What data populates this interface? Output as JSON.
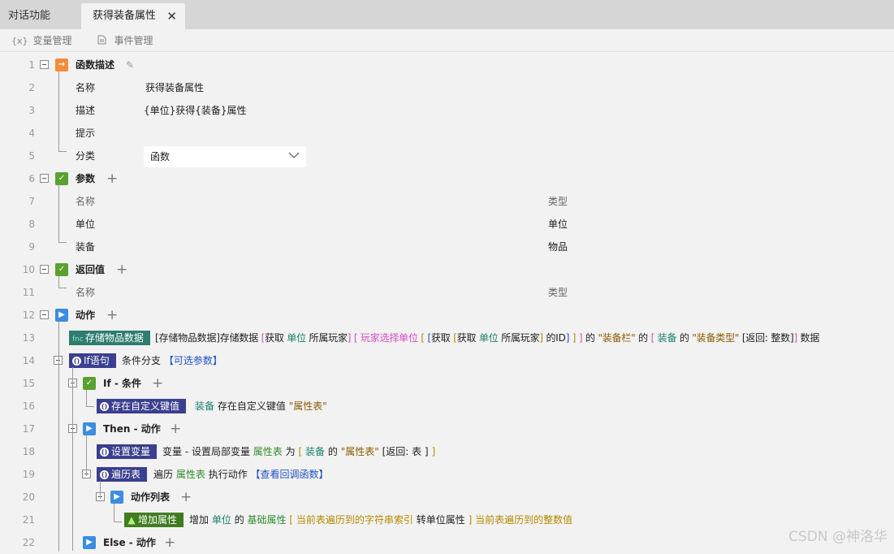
{
  "tabs": [
    {
      "label": "对话功能",
      "active": false
    },
    {
      "label": "获得装备属性",
      "active": true
    }
  ],
  "tab_close_glyph": "✕",
  "toolbar": {
    "vars_icon": "{x}",
    "vars_label": "变量管理",
    "events_label": "事件管理"
  },
  "line_numbers": [
    "1",
    "2",
    "3",
    "4",
    "5",
    "6",
    "7",
    "8",
    "9",
    "10",
    "11",
    "12",
    "13",
    "14",
    "15",
    "16",
    "17",
    "18",
    "19",
    "20",
    "21",
    "22"
  ],
  "func_desc": {
    "header": "函数描述",
    "name_label": "名称",
    "name_value": "获得装备属性",
    "desc_label": "描述",
    "desc_value": "{单位}获得{装备}属性",
    "hint_label": "提示",
    "category_label": "分类",
    "category_value": "函数"
  },
  "params": {
    "header": "参数",
    "col_name": "名称",
    "col_type": "类型",
    "rows": [
      {
        "name": "单位",
        "type": "单位"
      },
      {
        "name": "装备",
        "type": "物品"
      }
    ]
  },
  "return_value": {
    "header": "返回值",
    "col_name": "名称",
    "col_type": "类型"
  },
  "actions": {
    "header": "动作",
    "store": {
      "block": "存储物品数据",
      "parts": [
        "[存储物品数据]存储数据",
        "[",
        "获取",
        "单位",
        "所属玩家",
        "]",
        "[",
        "玩家选择单位",
        "[",
        "[",
        "获取",
        "[",
        "获取",
        "单位",
        "所属玩家",
        "]",
        "的ID",
        "]",
        "]",
        "]",
        "的",
        "\"装备栏\"",
        "的",
        "[",
        "装备",
        "的",
        "\"装备类型\"",
        "[返回: 整数]",
        "]",
        "数据"
      ]
    },
    "if_stmt": {
      "block": "If语句",
      "text": "条件分支",
      "optional": "【可选参数】",
      "if_label": "If - 条件",
      "cond_block": "存在自定义键值",
      "cond_parts": [
        "装备",
        "存在自定义键值",
        "\"属性表\""
      ],
      "then_label": "Then - 动作",
      "set_var": {
        "block": "设置变量",
        "parts": [
          "变量 - 设置局部变量",
          "属性表",
          "为",
          "[",
          "装备",
          "的",
          "\"属性表\"",
          "[返回: 表 ]",
          "]"
        ]
      },
      "loop": {
        "block": "遍历表",
        "parts": [
          "遍历",
          "属性表",
          "执行动作",
          "【查看回调函数】"
        ]
      },
      "action_list": "动作列表",
      "add_attr": {
        "block": "增加属性",
        "parts": [
          "增加",
          "单位",
          "的",
          "基础属性",
          "[",
          "当前表遍历到的字符串索引",
          "转单位属性",
          "]",
          "当前表遍历到的整数值"
        ]
      },
      "else_label": "Else - 动作"
    }
  },
  "watermark": "CSDN @神洛华",
  "colors": {
    "teal": "#2e7d6f",
    "indigo": "#3b3f8f",
    "green": "#3f7d1f",
    "orange": "#f28e3a",
    "blue": "#3a8de0"
  }
}
